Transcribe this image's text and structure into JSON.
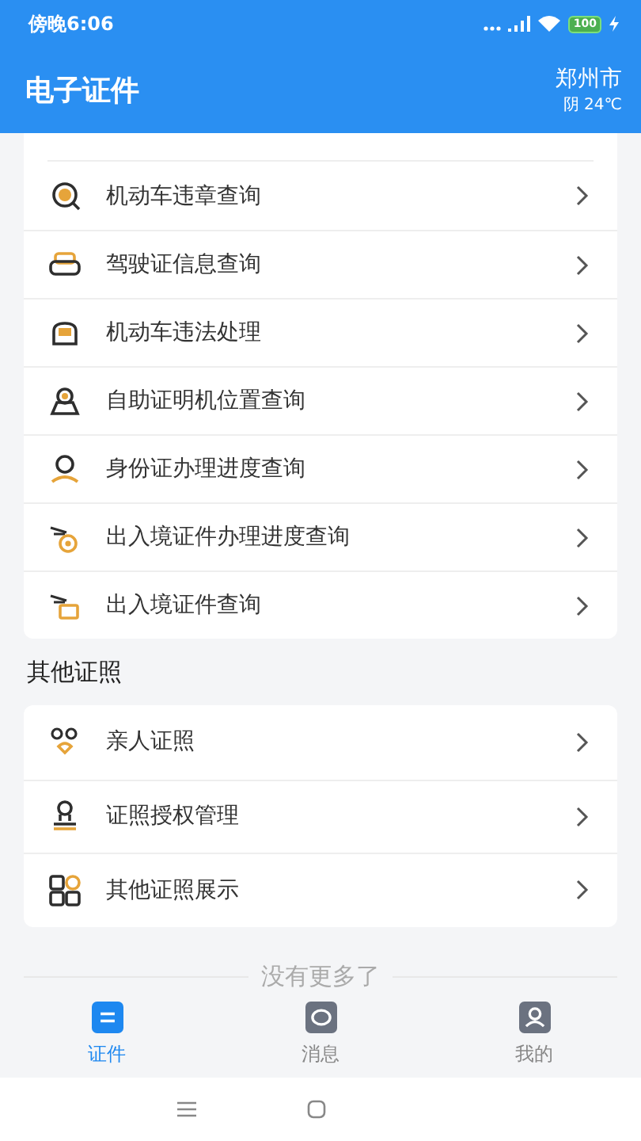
{
  "status_bar": {
    "time": "傍晚6:06",
    "battery": "100"
  },
  "header": {
    "title": "电子证件",
    "city": "郑州市",
    "weather": "阴 24℃"
  },
  "services": [
    {
      "label": "机动车违章查询"
    },
    {
      "label": "驾驶证信息查询"
    },
    {
      "label": "机动车违法处理"
    },
    {
      "label": "自助证明机位置查询"
    },
    {
      "label": "身份证办理进度查询"
    },
    {
      "label": "出入境证件办理进度查询"
    },
    {
      "label": "出入境证件查询"
    }
  ],
  "other_section": {
    "title": "其他证照",
    "items": [
      {
        "label": "亲人证照"
      },
      {
        "label": "证照授权管理"
      },
      {
        "label": "其他证照展示"
      }
    ]
  },
  "end_note": "没有更多了",
  "tabs": [
    {
      "label": "证件",
      "selected": true
    },
    {
      "label": "消息",
      "selected": false
    },
    {
      "label": "我的",
      "selected": false
    }
  ]
}
